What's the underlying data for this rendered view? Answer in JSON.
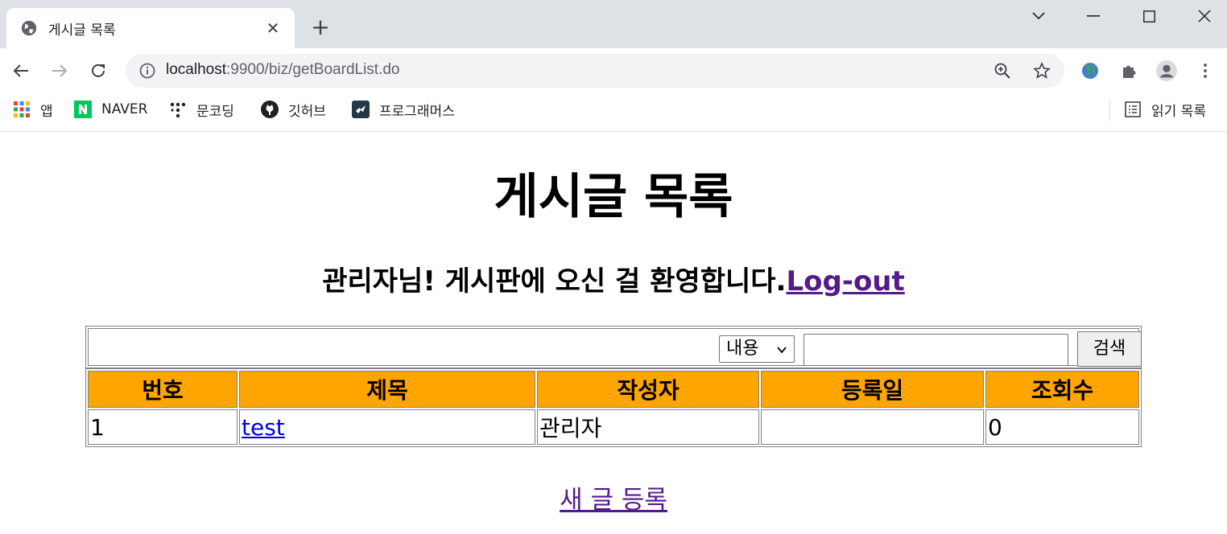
{
  "browser": {
    "tab_title": "게시글 목록",
    "url_host": "localhost",
    "url_rest": ":9900/biz/getBoardList.do",
    "bookmarks": [
      {
        "label": "앱"
      },
      {
        "label": "NAVER"
      },
      {
        "label": "문코딩"
      },
      {
        "label": "깃허브"
      },
      {
        "label": "프로그래머스"
      }
    ],
    "reading_list": "읽기 목록"
  },
  "page": {
    "title": "게시글 목록",
    "welcome": "관리자님! 게시판에 오신 걸 환영합니다.",
    "logout": "Log-out",
    "search": {
      "select_value": "내용",
      "keyword": "",
      "button": "검색"
    },
    "table": {
      "headers": [
        "번호",
        "제목",
        "작성자",
        "등록일",
        "조회수"
      ],
      "rows": [
        {
          "no": "1",
          "title": "test",
          "writer": "관리자",
          "date": "",
          "views": "0"
        }
      ]
    },
    "new_post": "새 글 등록"
  },
  "colors": {
    "header_bg": "#ffa500",
    "visited_link": "#551a8b",
    "link": "#0000ee",
    "naver_green": "#03c75a"
  }
}
